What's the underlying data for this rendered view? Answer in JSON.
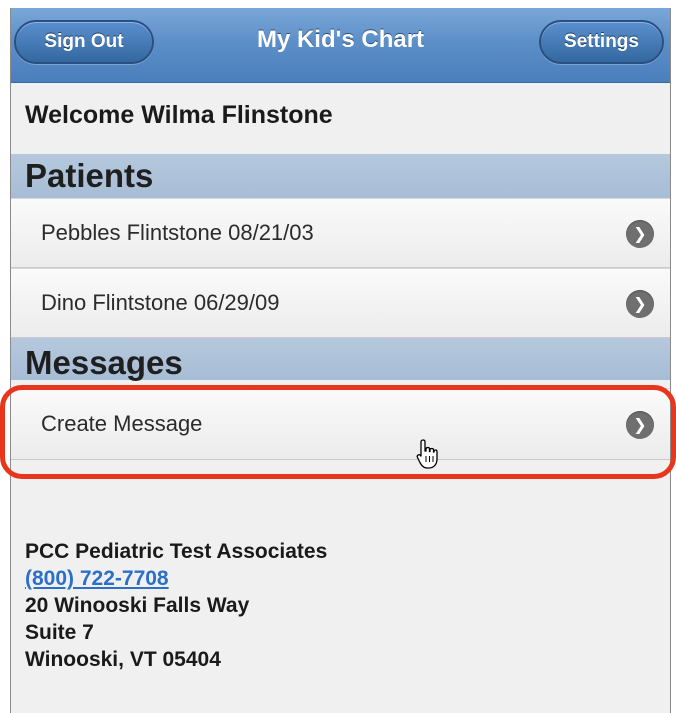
{
  "header": {
    "title": "My Kid's Chart",
    "sign_out_label": "Sign Out",
    "settings_label": "Settings"
  },
  "welcome": "Welcome Wilma Flinstone",
  "patients": {
    "heading": "Patients",
    "items": [
      {
        "label": "Pebbles Flintstone 08/21/03"
      },
      {
        "label": "Dino Flintstone 06/29/09"
      }
    ]
  },
  "messages": {
    "heading": "Messages",
    "items": [
      {
        "label": "Create Message"
      }
    ]
  },
  "practice": {
    "name": "PCC Pediatric Test Associates",
    "phone": "(800) 722-7708",
    "address1": "20 Winooski Falls Way",
    "address2": "Suite 7",
    "city_state_zip": "Winooski, VT 05404"
  },
  "colors": {
    "header_blue": "#5d8fc8",
    "section_blue": "#b5c8dd",
    "highlight_red": "#e8361e",
    "link_blue": "#2a6fc9"
  },
  "icons": {
    "row_chevron": "chevron-right-icon",
    "pointer": "hand-pointer-icon"
  }
}
